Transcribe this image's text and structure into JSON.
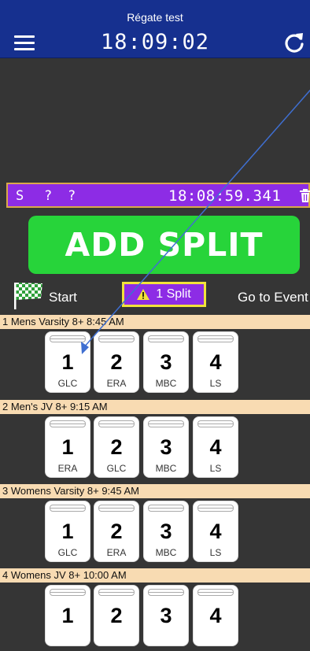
{
  "header": {
    "app_title": "Régate test",
    "clock": "18:09:02",
    "menu_icon": "hamburger-menu-icon",
    "refresh_icon": "refresh-icon",
    "background_color": "#16308f"
  },
  "split_bar": {
    "letter": "S",
    "bow1": "?",
    "bow2": "?",
    "time": "18:08:59.341",
    "trash_icon": "trash-icon",
    "background_color": "#8d2ce5"
  },
  "add_split": {
    "label": "ADD SPLIT",
    "color": "#27d43a"
  },
  "nav": {
    "start_label": "Start",
    "start_icon": "checkered-flag-icon",
    "splits_label": "1 Split",
    "splits_icon": "warning-icon",
    "goto_label": "Go to Event"
  },
  "events": [
    {
      "title": "1 Mens Varsity 8+ 8:45 AM",
      "lanes": [
        {
          "num": "1",
          "crew": "GLC"
        },
        {
          "num": "2",
          "crew": "ERA"
        },
        {
          "num": "3",
          "crew": "MBC"
        },
        {
          "num": "4",
          "crew": "LS"
        }
      ]
    },
    {
      "title": "2 Men's JV 8+ 9:15 AM",
      "lanes": [
        {
          "num": "1",
          "crew": "ERA"
        },
        {
          "num": "2",
          "crew": "GLC"
        },
        {
          "num": "3",
          "crew": "MBC"
        },
        {
          "num": "4",
          "crew": "LS"
        }
      ]
    },
    {
      "title": "3 Womens Varsity 8+ 9:45 AM",
      "lanes": [
        {
          "num": "1",
          "crew": "GLC"
        },
        {
          "num": "2",
          "crew": "ERA"
        },
        {
          "num": "3",
          "crew": "MBC"
        },
        {
          "num": "4",
          "crew": "LS"
        }
      ]
    },
    {
      "title": "4 Womens JV 8+ 10:00 AM",
      "lanes": [
        {
          "num": "1",
          "crew": ""
        },
        {
          "num": "2",
          "crew": ""
        },
        {
          "num": "3",
          "crew": ""
        },
        {
          "num": "4",
          "crew": ""
        }
      ]
    }
  ]
}
